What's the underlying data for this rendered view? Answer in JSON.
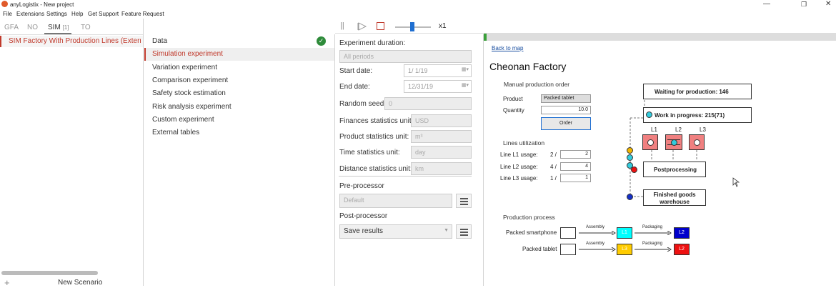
{
  "window": {
    "title": "anyLogistix - New project"
  },
  "menu": [
    "File",
    "Extensions",
    "Settings",
    "Help",
    "Get Support",
    "Feature Request"
  ],
  "left": {
    "tabs": [
      {
        "label": "GFA"
      },
      {
        "label": "NO"
      },
      {
        "label": "SIM",
        "badge": "[1]"
      },
      {
        "label": "TO"
      }
    ],
    "scenario": "SIM Factory With Production Lines (Externa",
    "new_scenario": "New Scenario"
  },
  "nav": {
    "items": [
      "Data",
      "Simulation experiment",
      "Variation experiment",
      "Comparison experiment",
      "Safety stock estimation",
      "Risk analysis experiment",
      "Custom experiment",
      "External tables"
    ],
    "active_index": 1
  },
  "toolbar": {
    "speed": "x1",
    "slider_fraction": 0.48
  },
  "form": {
    "duration_label": "Experiment duration:",
    "duration_value": "All periods",
    "start_label": "Start date:",
    "start_value": "1/  1/19",
    "end_label": "End date:",
    "end_value": "12/31/19",
    "seed_label": "Random seed:",
    "seed_value": "0",
    "fin_label": "Finances statistics unit:",
    "fin_value": "USD",
    "prod_label": "Product statistics unit:",
    "prod_value": "m³",
    "time_label": "Time statistics unit:",
    "time_value": "day",
    "dist_label": "Distance statistics unit:",
    "dist_value": "km",
    "pre_label": "Pre-processor",
    "pre_value": "Default",
    "post_label": "Post-processor",
    "post_value": "Save results"
  },
  "map": {
    "back": "Back to map",
    "title": "Cheonan Factory",
    "manual_order": "Manual production order",
    "product_label": "Product",
    "product_value": "Packed tablet",
    "quantity_label": "Quantity",
    "quantity_value": "10.0",
    "order_btn": "Order",
    "lines_util": "Lines utilization",
    "l1_label": "Line L1 usage:",
    "l1_ratio": "2 /",
    "l1_value": "2",
    "l2_label": "Line L2 usage:",
    "l2_ratio": "4 /",
    "l2_value": "4",
    "l3_label": "Line L3 usage:",
    "l3_ratio": "1 /",
    "l3_value": "1",
    "waiting": "Waiting for production: 146",
    "wip": "Work in progress: 215(71)",
    "line_names": [
      "L1",
      "L2",
      "L3"
    ],
    "postprocessing": "Postprocessing",
    "finished": "Finished goods warehouse",
    "production_process": "Production process",
    "pp_rows": [
      {
        "product": "Packed smartphone",
        "step1": "Assembly",
        "line1": "L1",
        "line1_color": "#00ffff",
        "step2": "Packaging",
        "line2": "L2",
        "line2_color": "#0000cc"
      },
      {
        "product": "Packed tablet",
        "step1": "Assembly",
        "line1": "L3",
        "line1_color": "#ffcc00",
        "step2": "Packaging",
        "line2": "L2",
        "line2_color": "#ee1111"
      }
    ]
  }
}
